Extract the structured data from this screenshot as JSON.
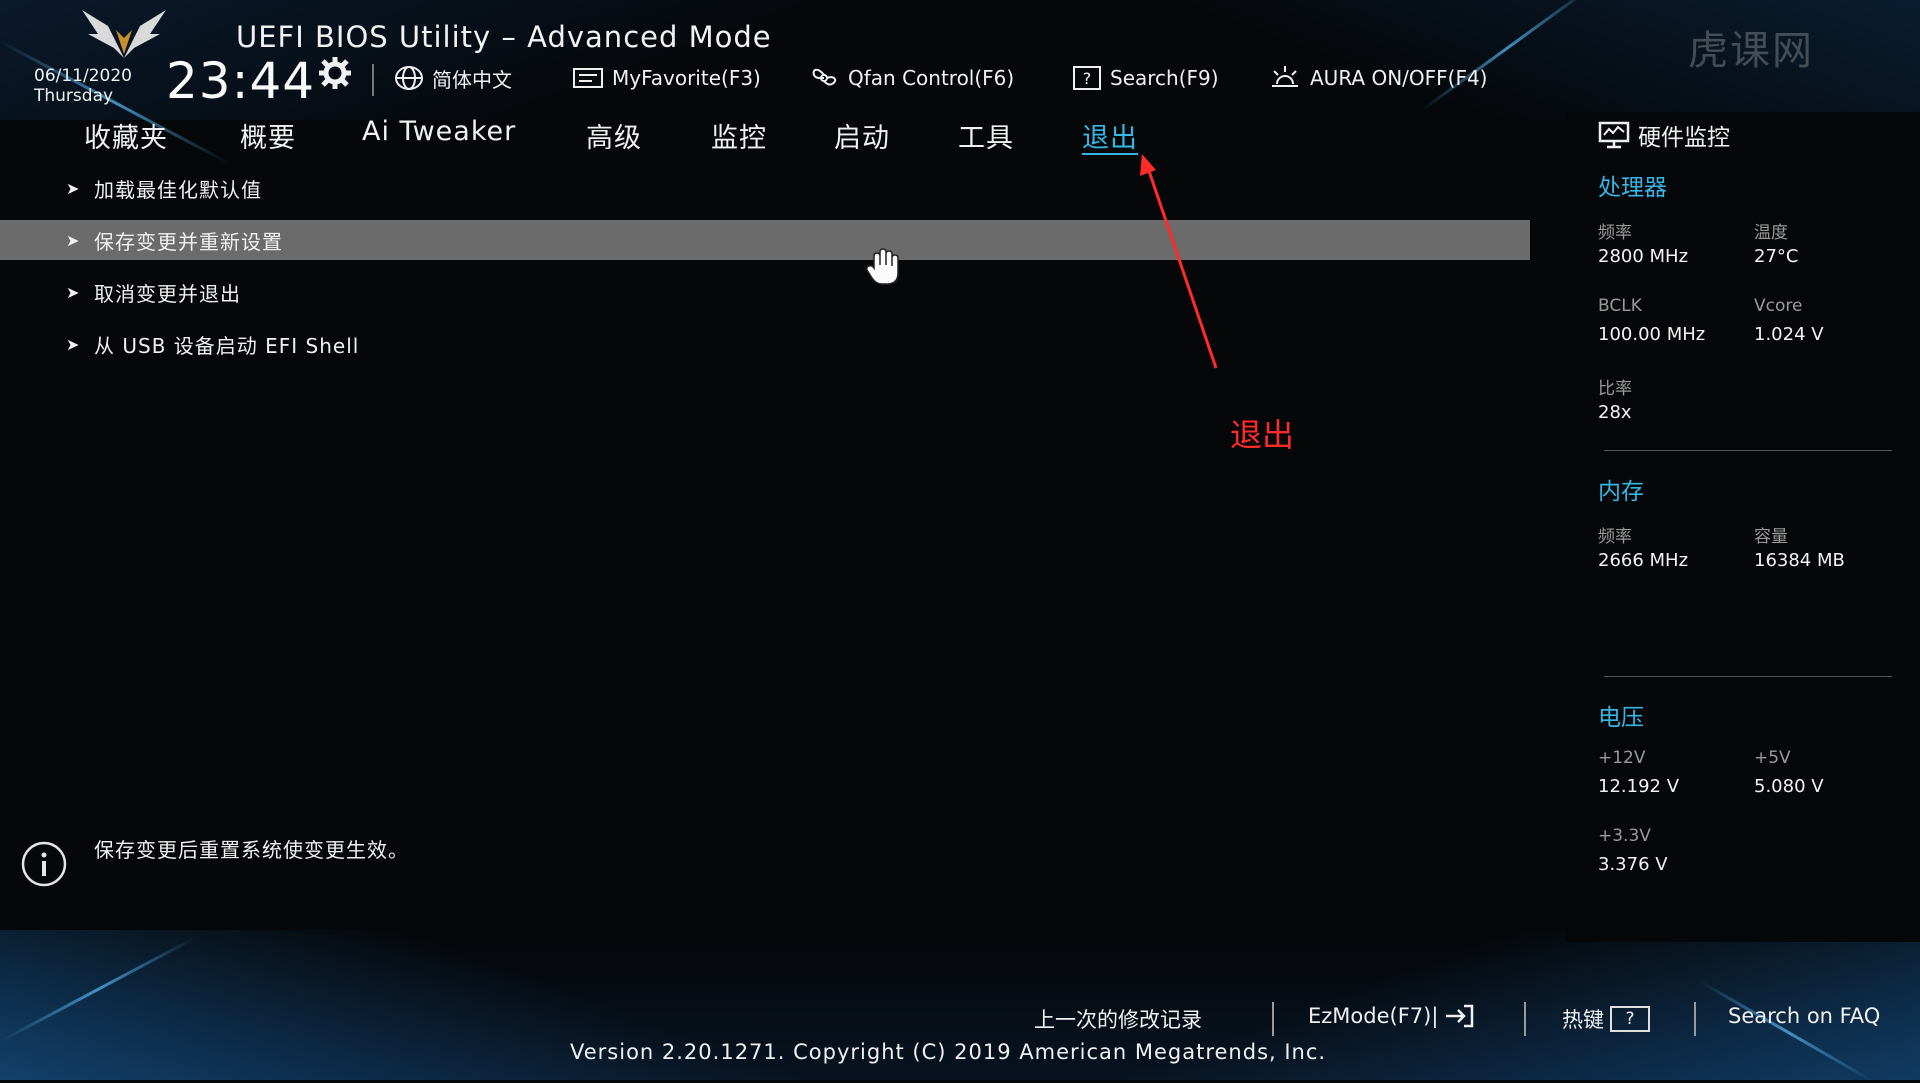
{
  "header": {
    "title": "UEFI BIOS Utility – Advanced Mode",
    "date": "06/11/2020",
    "weekday": "Thursday",
    "time": "23:44",
    "watermark": "虎课网",
    "toolbar": [
      {
        "label": "简体中文",
        "icon": "globe-icon"
      },
      {
        "label": "MyFavorite(F3)",
        "icon": "favorite-icon"
      },
      {
        "label": "Qfan Control(F6)",
        "icon": "fan-icon"
      },
      {
        "label": "Search(F9)",
        "icon": "search-icon"
      },
      {
        "label": "AURA ON/OFF(F4)",
        "icon": "aura-icon"
      }
    ]
  },
  "nav": {
    "tabs": [
      {
        "label": "收藏夹"
      },
      {
        "label": "概要"
      },
      {
        "label": "Ai Tweaker"
      },
      {
        "label": "高级"
      },
      {
        "label": "监控"
      },
      {
        "label": "启动"
      },
      {
        "label": "工具"
      },
      {
        "label": "退出",
        "active": true
      }
    ]
  },
  "menu": {
    "items": [
      {
        "label": "加载最佳化默认值"
      },
      {
        "label": "保存变更并重新设置",
        "selected": true
      },
      {
        "label": "取消变更并退出"
      },
      {
        "label": "从 USB 设备启动 EFI Shell"
      }
    ]
  },
  "annotation": {
    "text": "退出",
    "color": "#ff2a2a"
  },
  "info": {
    "text": "保存变更后重置系统使变更生效。"
  },
  "hardware_monitor": {
    "title": "硬件监控",
    "cpu": {
      "section": "处理器",
      "freq_label": "频率",
      "freq_value": "2800 MHz",
      "temp_label": "温度",
      "temp_value": "27°C",
      "bclk_label": "BCLK",
      "bclk_value": "100.00 MHz",
      "vcore_label": "Vcore",
      "vcore_value": "1.024 V",
      "ratio_label": "比率",
      "ratio_value": "28x"
    },
    "memory": {
      "section": "内存",
      "freq_label": "频率",
      "freq_value": "2666 MHz",
      "cap_label": "容量",
      "cap_value": "16384 MB"
    },
    "voltage": {
      "section": "电压",
      "v12_label": "+12V",
      "v12_value": "12.192 V",
      "v5_label": "+5V",
      "v5_value": "5.080 V",
      "v33_label": "+3.3V",
      "v33_value": "3.376 V"
    }
  },
  "footer": {
    "last_modified": "上一次的修改记录",
    "ezmode": "EzMode(F7)|",
    "hotkeys": "热键",
    "hotkeys_key": "?",
    "faq": "Search on FAQ",
    "version": "Version 2.20.1271. Copyright (C) 2019 American Megatrends, Inc."
  },
  "colors": {
    "accent": "#37b6e6",
    "selected_row": "#6b6b6b",
    "annotation": "#ff2a2a",
    "background": "#050709"
  }
}
